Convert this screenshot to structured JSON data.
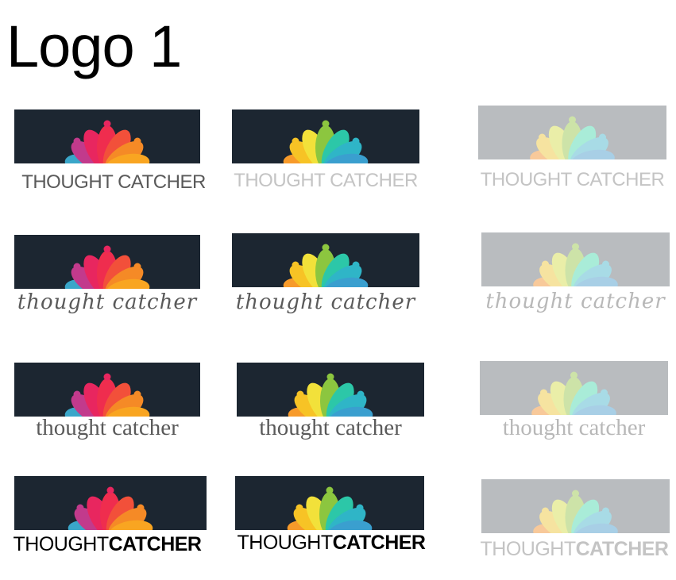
{
  "page": {
    "title": "Logo 1"
  },
  "colors": {
    "dark_banner": "#1c2631",
    "gray_banner": "#b9bcbf",
    "text_gray": "#5a5a5a",
    "text_light": "#c4c4c4",
    "text_black": "#000000"
  },
  "variants": [
    {
      "style": "sans",
      "palette": "warm",
      "text": "THOUGHT CATCHER"
    },
    {
      "style": "sans",
      "palette": "cool",
      "text": "THOUGHT CATCHER"
    },
    {
      "style": "sans",
      "palette": "faded",
      "text": "THOUGHT CATCHER"
    },
    {
      "style": "script",
      "palette": "warm",
      "text": "thought catcher"
    },
    {
      "style": "script",
      "palette": "cool",
      "text": "thought catcher"
    },
    {
      "style": "script",
      "palette": "faded",
      "text": "thought catcher"
    },
    {
      "style": "serif",
      "palette": "warm",
      "text": "thought catcher"
    },
    {
      "style": "serif",
      "palette": "cool",
      "text": "thought catcher"
    },
    {
      "style": "serif",
      "palette": "faded",
      "text": "thought catcher"
    },
    {
      "style": "bold",
      "palette": "warm",
      "text_light": "THOUGHT",
      "text_bold": "CATCHER"
    },
    {
      "style": "bold",
      "palette": "cool",
      "text_light": "THOUGHT",
      "text_bold": "CATCHER"
    },
    {
      "style": "bold",
      "palette": "faded",
      "text_light": "THOUGHT",
      "text_bold": "CATCHER"
    }
  ]
}
